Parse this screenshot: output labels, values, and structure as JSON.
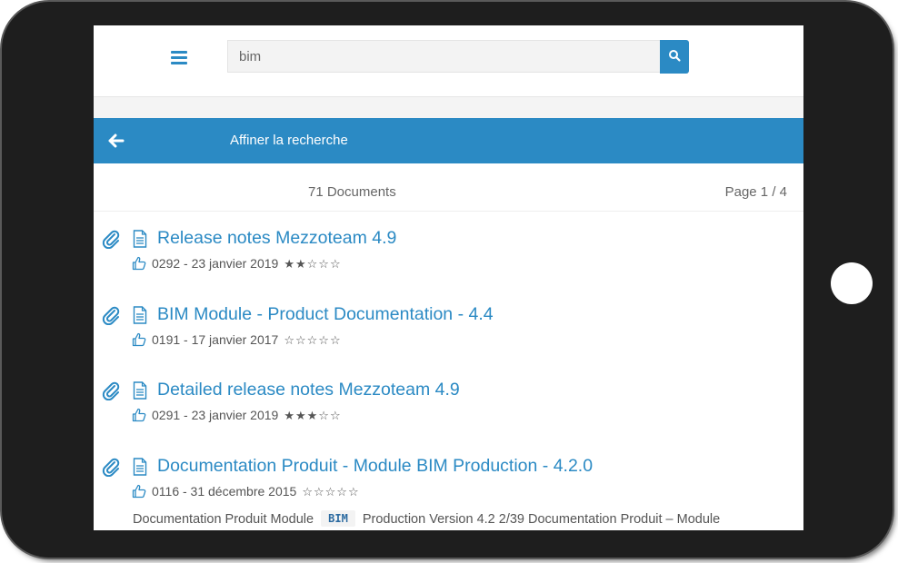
{
  "search": {
    "query": "bim"
  },
  "refine": {
    "label": "Affiner la recherche"
  },
  "summary": {
    "count": "71 Documents",
    "page": "Page 1 / 4"
  },
  "results": [
    {
      "title": "Release notes Mezzoteam 4.9",
      "meta": "0292 - 23 janvier 2019",
      "rating": 2
    },
    {
      "title": "BIM Module - Product Documentation - 4.4",
      "meta": "0191 - 17 janvier 2017",
      "rating": 0
    },
    {
      "title": "Detailed release notes Mezzoteam 4.9",
      "meta": "0291 - 23 janvier 2019",
      "rating": 3
    },
    {
      "title": "Documentation Produit - Module BIM Production - 4.2.0",
      "meta": "0116 - 31 décembre 2015",
      "rating": 0
    }
  ],
  "excerpt": {
    "before": "Documentation Produit Module",
    "keyword": "BIM",
    "after": "Production Version 4.2 2/39 Documentation Produit – Module"
  },
  "colors": {
    "accent": "#2b8ac4",
    "frame": "#1e1e1e"
  },
  "icons": [
    "menu-icon",
    "search-icon",
    "arrow-left-icon",
    "paperclip-icon",
    "document-icon",
    "thumbs-up-icon",
    "star-icon"
  ]
}
